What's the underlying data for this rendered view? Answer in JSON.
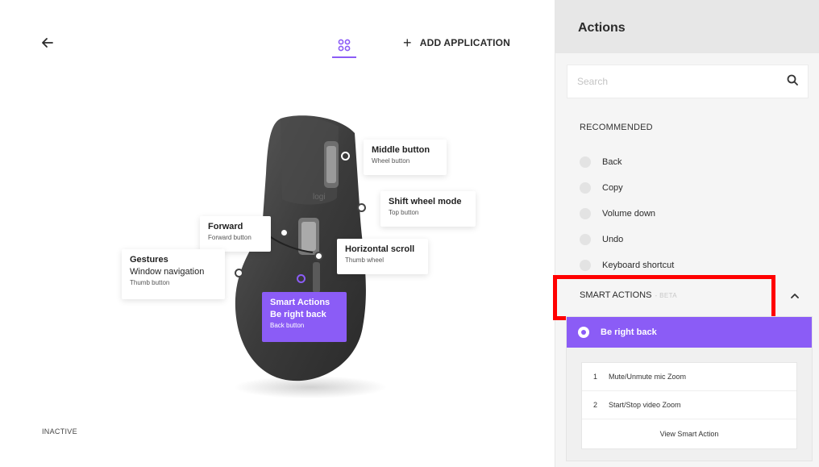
{
  "header": {
    "add_application_label": "ADD APPLICATION"
  },
  "callouts": {
    "middle_button": {
      "title": "Middle button",
      "sub": "Wheel button"
    },
    "shift_wheel": {
      "title": "Shift wheel mode",
      "sub": "Top button"
    },
    "forward": {
      "title": "Forward",
      "sub": "Forward button"
    },
    "horizontal_scroll": {
      "title": "Horizontal scroll",
      "sub": "Thumb wheel"
    },
    "gestures": {
      "title": "Gestures",
      "mapping": "Window navigation",
      "sub": "Thumb button"
    },
    "smart_actions": {
      "title": "Smart Actions",
      "mapping": "Be right back",
      "sub": "Back button"
    }
  },
  "status": {
    "inactive_label": "INACTIVE"
  },
  "panel": {
    "title": "Actions",
    "search_placeholder": "Search",
    "recommended_label": "RECOMMENDED",
    "recommended_items": [
      {
        "label": "Back"
      },
      {
        "label": "Copy"
      },
      {
        "label": "Volume down"
      },
      {
        "label": "Undo"
      },
      {
        "label": "Keyboard shortcut"
      }
    ],
    "smart_actions_label": "SMART ACTIONS",
    "beta_label": "- BETA",
    "selected_smart_action": "Be right back",
    "steps": [
      {
        "num": "1",
        "label": "Mute/Unmute mic Zoom"
      },
      {
        "num": "2",
        "label": "Start/Stop video Zoom"
      }
    ],
    "view_smart_action_label": "View Smart Action"
  },
  "colors": {
    "accent": "#8b5cf6",
    "highlight_box": "#ff0000",
    "panel_bg": "#f5f5f5"
  }
}
